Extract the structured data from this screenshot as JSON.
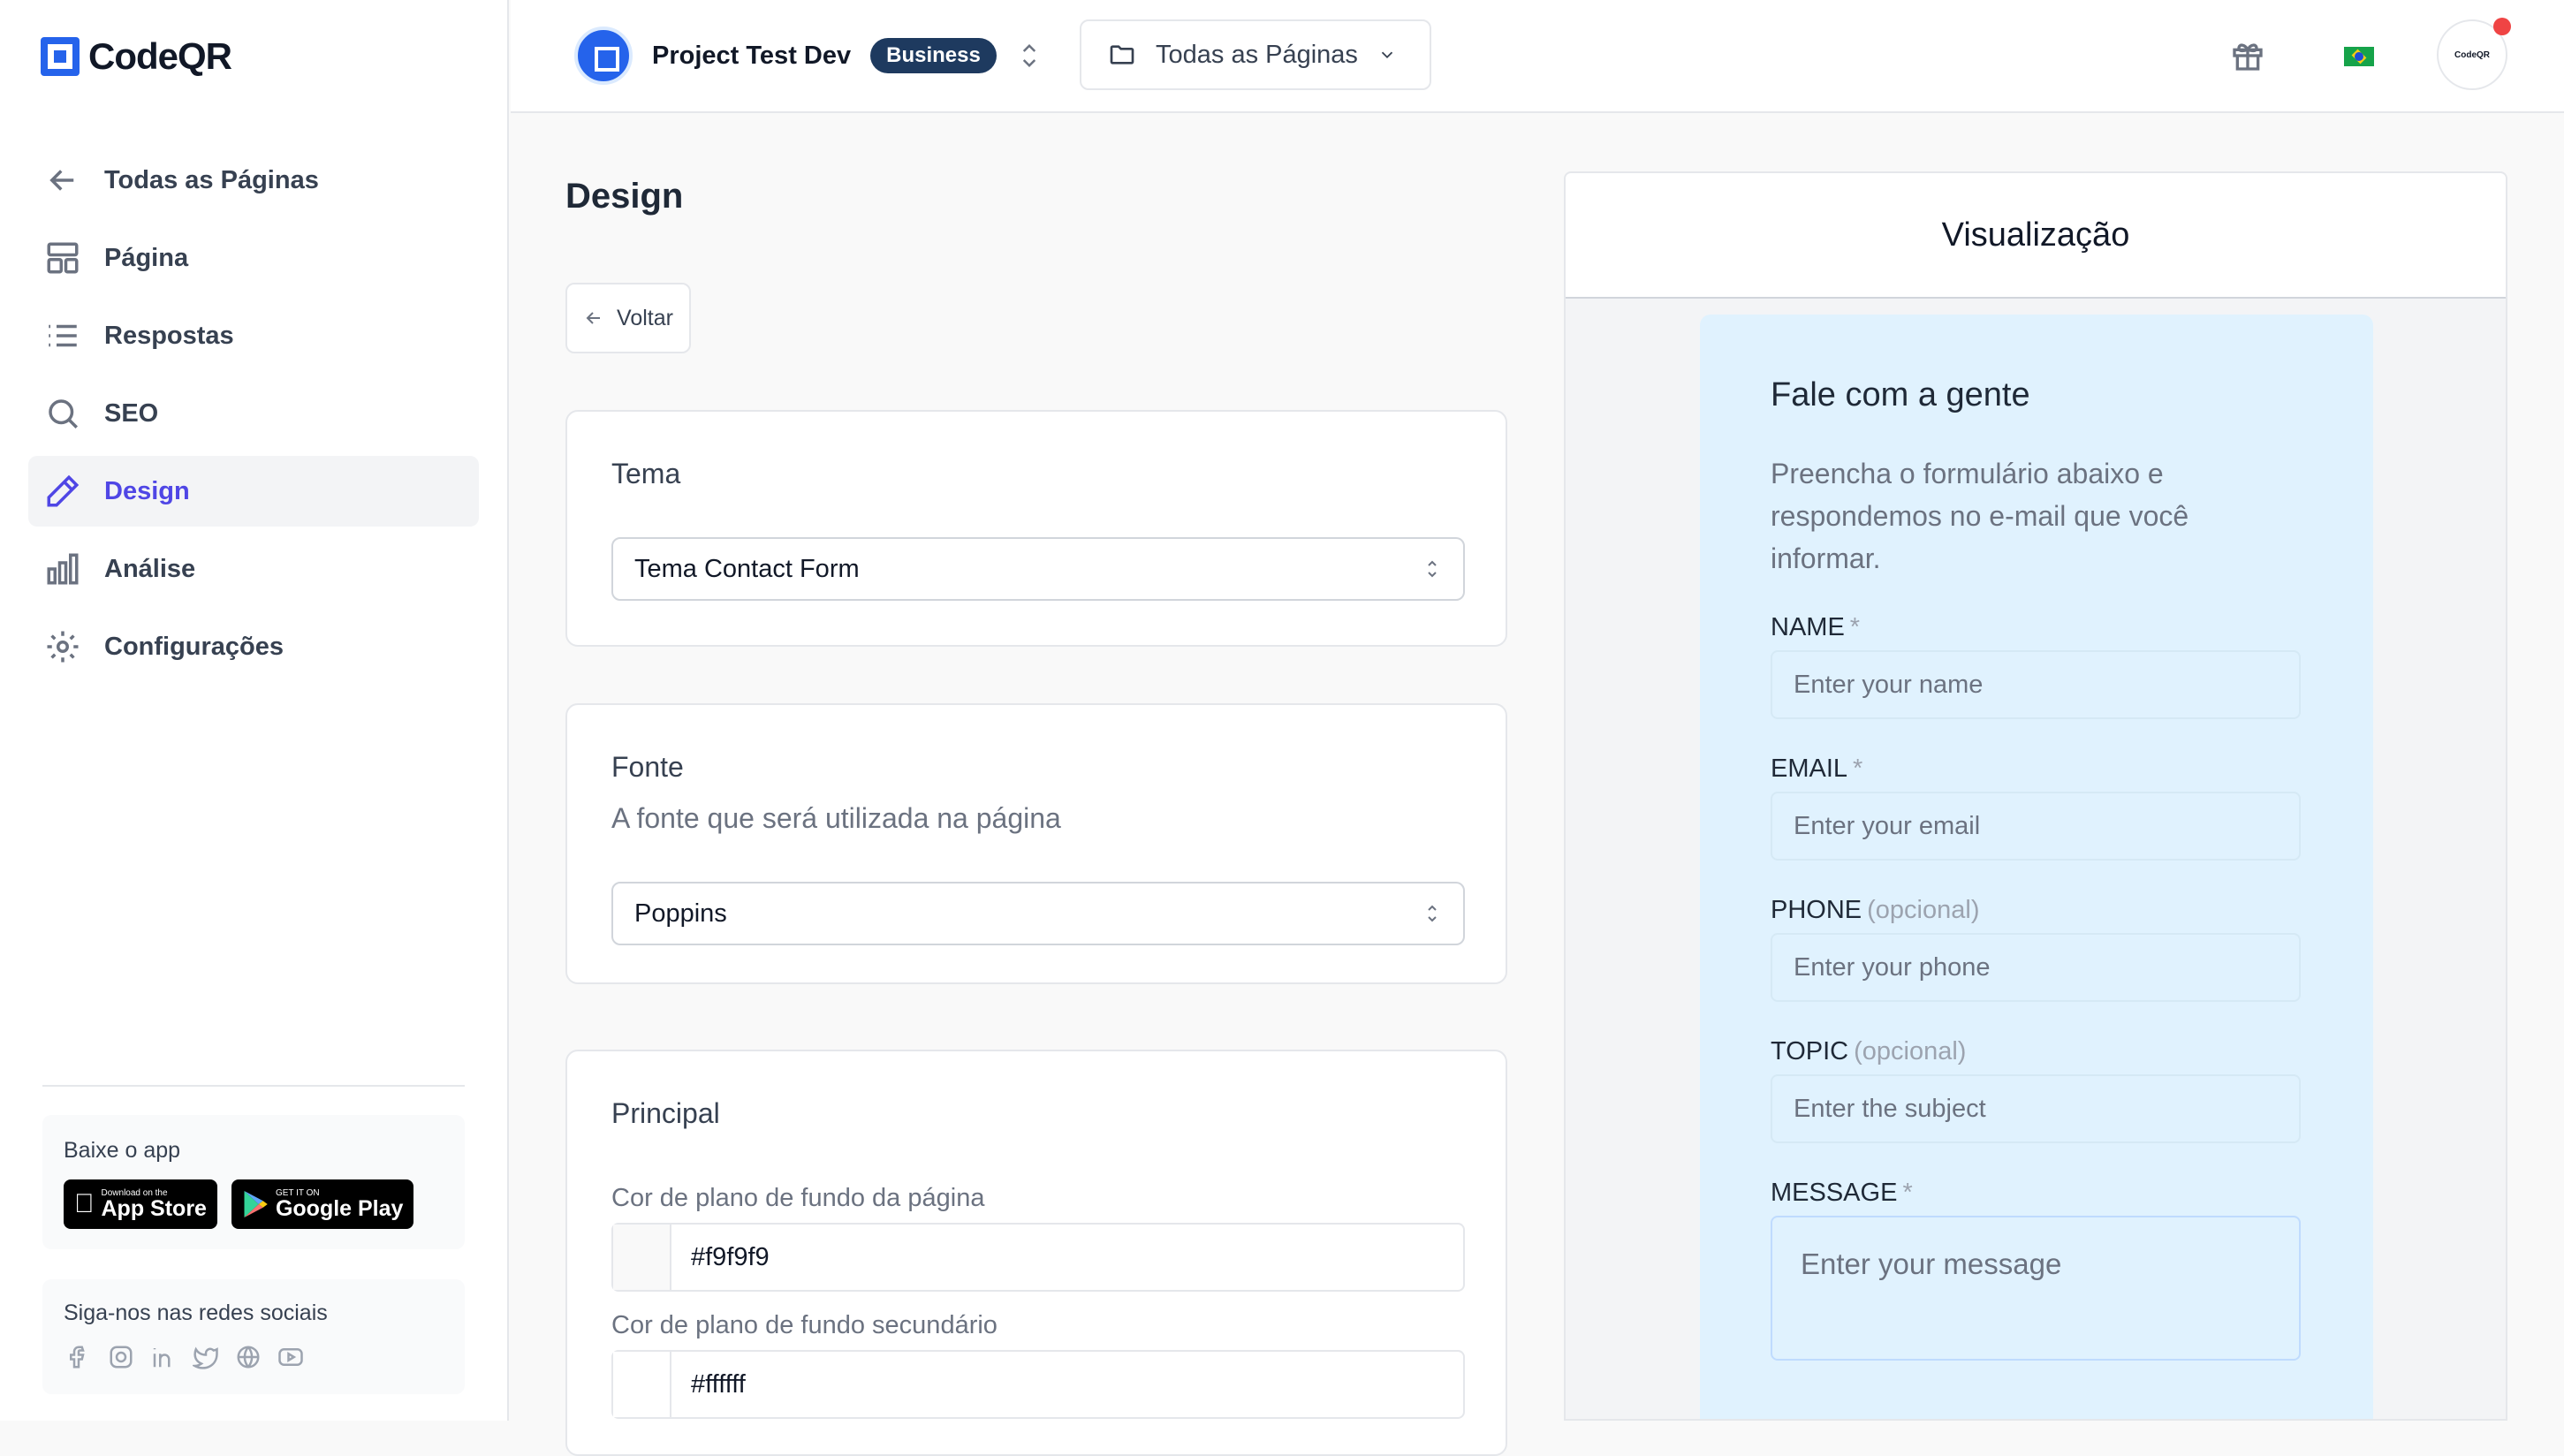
{
  "brand": {
    "name": "CodeQR",
    "avatar_text": "CodeQR"
  },
  "sidebar": {
    "items": [
      {
        "label": "Todas as Páginas",
        "icon": "arrow-left-icon"
      },
      {
        "label": "Página",
        "icon": "layout-icon"
      },
      {
        "label": "Respostas",
        "icon": "list-icon"
      },
      {
        "label": "SEO",
        "icon": "search-icon"
      },
      {
        "label": "Design",
        "icon": "pencil-icon",
        "active": true
      },
      {
        "label": "Análise",
        "icon": "bar-chart-icon"
      },
      {
        "label": "Configurações",
        "icon": "gear-icon"
      }
    ],
    "app_box": {
      "title": "Baixe o app",
      "appstore_small": "Download on the",
      "appstore_big": "App Store",
      "googleplay_small": "GET IT ON",
      "googleplay_big": "Google Play"
    },
    "social": {
      "title": "Siga-nos nas redes sociais",
      "icons": [
        "facebook-icon",
        "instagram-icon",
        "linkedin-icon",
        "twitter-icon",
        "globe-icon",
        "youtube-icon"
      ]
    }
  },
  "topbar": {
    "project_name": "Project Test Dev",
    "plan_badge": "Business",
    "pages_dropdown": "Todas as Páginas",
    "icons": [
      "gift-icon",
      "brazil-flag-icon"
    ]
  },
  "editor": {
    "title": "Design",
    "back_label": "Voltar",
    "tema": {
      "title": "Tema",
      "selected": "Tema Contact Form"
    },
    "fonte": {
      "title": "Fonte",
      "subtitle": "A fonte que será utilizada na página",
      "selected": "Poppins"
    },
    "principal": {
      "title": "Principal",
      "bg_label": "Cor de plano de fundo da página",
      "bg_value": "#f9f9f9",
      "bg2_label": "Cor de plano de fundo secundário",
      "bg2_value": "#ffffff"
    }
  },
  "preview": {
    "title": "Visualização",
    "form": {
      "title": "Fale com a gente",
      "description": "Preencha o formulário abaixo e respondemos no e-mail que você informar.",
      "required_mark": "*",
      "optional_mark": "(opcional)",
      "fields": {
        "name": {
          "label": "NAME",
          "placeholder": "Enter your name"
        },
        "email": {
          "label": "EMAIL",
          "placeholder": "Enter your email"
        },
        "phone": {
          "label": "PHONE",
          "placeholder": "Enter your phone"
        },
        "topic": {
          "label": "TOPIC",
          "placeholder": "Enter the subject"
        },
        "message": {
          "label": "MESSAGE",
          "placeholder": "Enter your message"
        }
      }
    }
  },
  "colors": {
    "accent": "#4f46e5",
    "brand": "#2563eb",
    "badge": "#1e3a5f",
    "form_bg": "#e0f2fe"
  }
}
